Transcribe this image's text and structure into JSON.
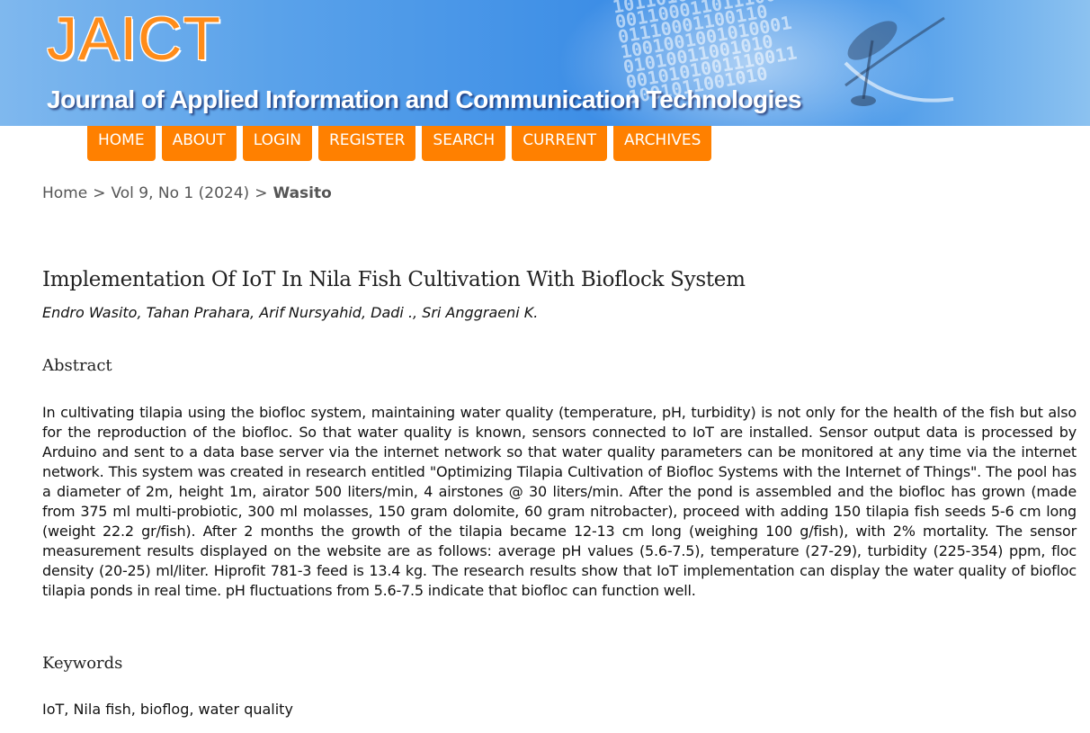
{
  "header": {
    "logo": "JAICT",
    "journal_name": "Journal of Applied Information and Communication Technologies",
    "binary_text": "10110100101\n0011000110111000\n01110001100110\n1001001001010001\n01010011001010\n0010101001110011\n1001011001010"
  },
  "nav": {
    "items": [
      {
        "label": "HOME"
      },
      {
        "label": "ABOUT"
      },
      {
        "label": "LOGIN"
      },
      {
        "label": "REGISTER"
      },
      {
        "label": "SEARCH"
      },
      {
        "label": "CURRENT"
      },
      {
        "label": "ARCHIVES"
      }
    ],
    "color": "#ff8000"
  },
  "breadcrumb": {
    "home": "Home",
    "separator": ">",
    "issue": "Vol 9, No 1 (2024)",
    "current": "Wasito"
  },
  "article": {
    "title": "Implementation Of IoT In Nila Fish Cultivation With Bioflock System",
    "authors": "Endro Wasito, Tahan Prahara, Arif Nursyahid, Dadi ., Sri Anggraeni K.",
    "abstract_heading": "Abstract",
    "abstract": "In cultivating tilapia using the biofloc system, maintaining water quality (temperature, pH, turbidity) is not only for the health of the fish but also for the reproduction of the biofloc. So that water quality is known, sensors connected to IoT are installed. Sensor output data is processed by Arduino and sent to a data base server via the internet network so that water quality parameters can be monitored at any time via the internet network. This system was created in research entitled \"Optimizing Tilapia Cultivation of Biofloc Systems with the Internet of Things\". The pool has a diameter of 2m, height 1m, airator 500 liters/min, 4 airstones @ 30 liters/min. After the pond is assembled and the biofloc has grown (made from 375 ml multi-probiotic, 300 ml molasses, 150 gram dolomite, 60 gram nitrobacter), proceed with adding 150 tilapia fish seeds 5-6 cm long (weight 22.2 gr/fish). After 2 months the growth of the tilapia became 12-13 cm long (weighing 100 g/fish), with 2% mortality. The sensor measurement results displayed on the website are as follows: average pH values (5.6-7.5), temperature (27-29), turbidity (225-354) ppm, floc density (20-25) ml/liter. Hiprofit 781-3 feed is 13.4 kg. The research results show that IoT implementation can display the water quality of biofloc tilapia ponds in real time. pH fluctuations from 5.6-7.5 indicate that biofloc can function well.",
    "keywords_heading": "Keywords",
    "keywords": "IoT, Nila fish, bioflog, water quality"
  }
}
